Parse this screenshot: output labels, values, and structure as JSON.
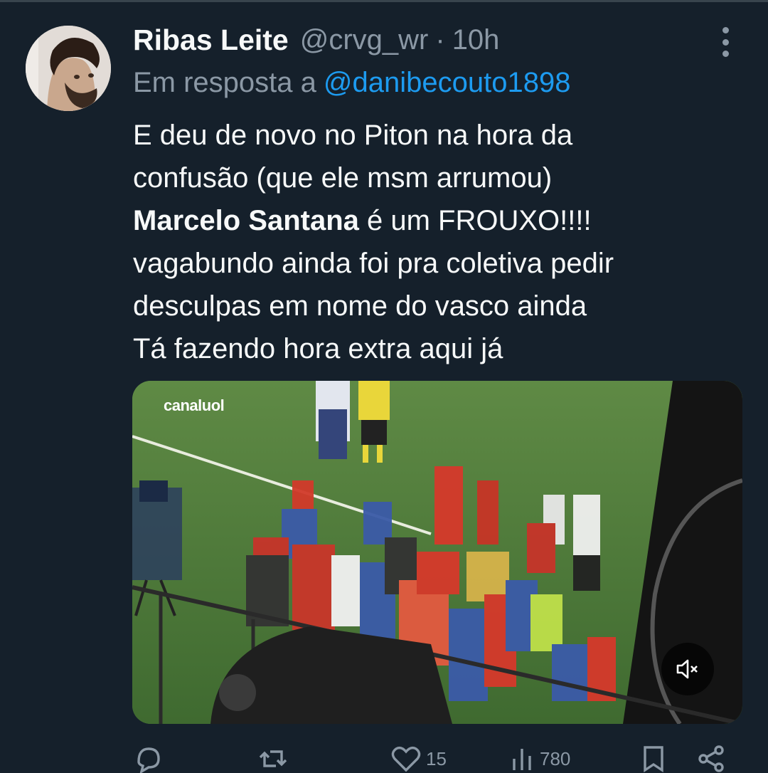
{
  "tweet": {
    "author_name": "Ribas Leite",
    "author_handle": "@crvg_wr",
    "separator": "·",
    "time": "10h",
    "reply_prefix": "Em resposta a",
    "reply_to": "@danibecouto1898",
    "text_lines": [
      "E deu de novo no Piton na hora da",
      "confusão (que ele msm arrumou)",
      " é um FROUXO!!!!",
      "vagabundo ainda foi pra coletiva pedir",
      "desculpas em nome do vasco ainda",
      "Tá fazendo hora extra aqui já"
    ],
    "bold_name": "Marcelo Santana",
    "media": {
      "channel_logo": "canal",
      "channel_logo_brand": "uol",
      "mute_icon": "speaker-muted-icon"
    },
    "actions": {
      "reply_count": "",
      "retweet_count": "",
      "like_count": "15",
      "views_count": "780"
    }
  },
  "icons": [
    "more-icon",
    "reply-icon",
    "retweet-icon",
    "like-icon",
    "views-icon",
    "bookmark-icon",
    "share-icon",
    "speaker-muted-icon"
  ],
  "colors": {
    "background": "#15202b",
    "primary_text": "#f7f9f9",
    "secondary_text": "#8b98a5",
    "link": "#1d9bf0"
  }
}
